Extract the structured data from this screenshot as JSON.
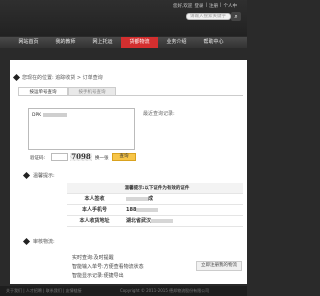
{
  "header": {
    "top_links": [
      "您好,欢迎",
      "登录",
      "|",
      "注册",
      "|",
      "个人中"
    ],
    "search_placeholder": "请输入搜索关键字",
    "search_button_icon": "search-icon"
  },
  "nav": {
    "items": [
      {
        "label": "网站首页",
        "active": false
      },
      {
        "label": "我的教师",
        "active": false
      },
      {
        "label": "网上托运",
        "active": false
      },
      {
        "label": "货都物流",
        "active": true
      },
      {
        "label": "业务介绍",
        "active": false
      },
      {
        "label": "帮助中心",
        "active": false
      }
    ]
  },
  "breadcrumb": "您现在的位置: 追踪收货 > 订单查询",
  "tabs": [
    {
      "label": "按运单号查询",
      "active": true
    },
    {
      "label": "按手机号查询",
      "active": false
    }
  ],
  "query": {
    "tracking_prefix": "DPK",
    "hint": "最近查询记录:",
    "captcha_label": "验证码:",
    "captcha_code": "7098",
    "captcha_refresh": "换一张",
    "submit_label": "查询"
  },
  "notice": {
    "title": "温馨提示:",
    "table_heading": "温馨提示:以下证件为有效的证件",
    "rows": [
      {
        "key": "本人签收",
        "value": "成"
      },
      {
        "key": "本人手机号",
        "value": "188"
      },
      {
        "key": "本人收货地址",
        "value": "湖北省武汉"
      }
    ]
  },
  "logistics": {
    "title": "审核物流:",
    "lines": [
      "实时查询:及时提醒",
      "智能输入单号:方便查看物流状态",
      "智能显示记录:便捷导出"
    ],
    "button_label": "立即注册我的物流"
  },
  "footer": {
    "left": "关于我们 | 人才招聘 | 联系我们 | 友情链接",
    "right": "Copyright © 2011-2015 德邦物流股份有限公司"
  }
}
